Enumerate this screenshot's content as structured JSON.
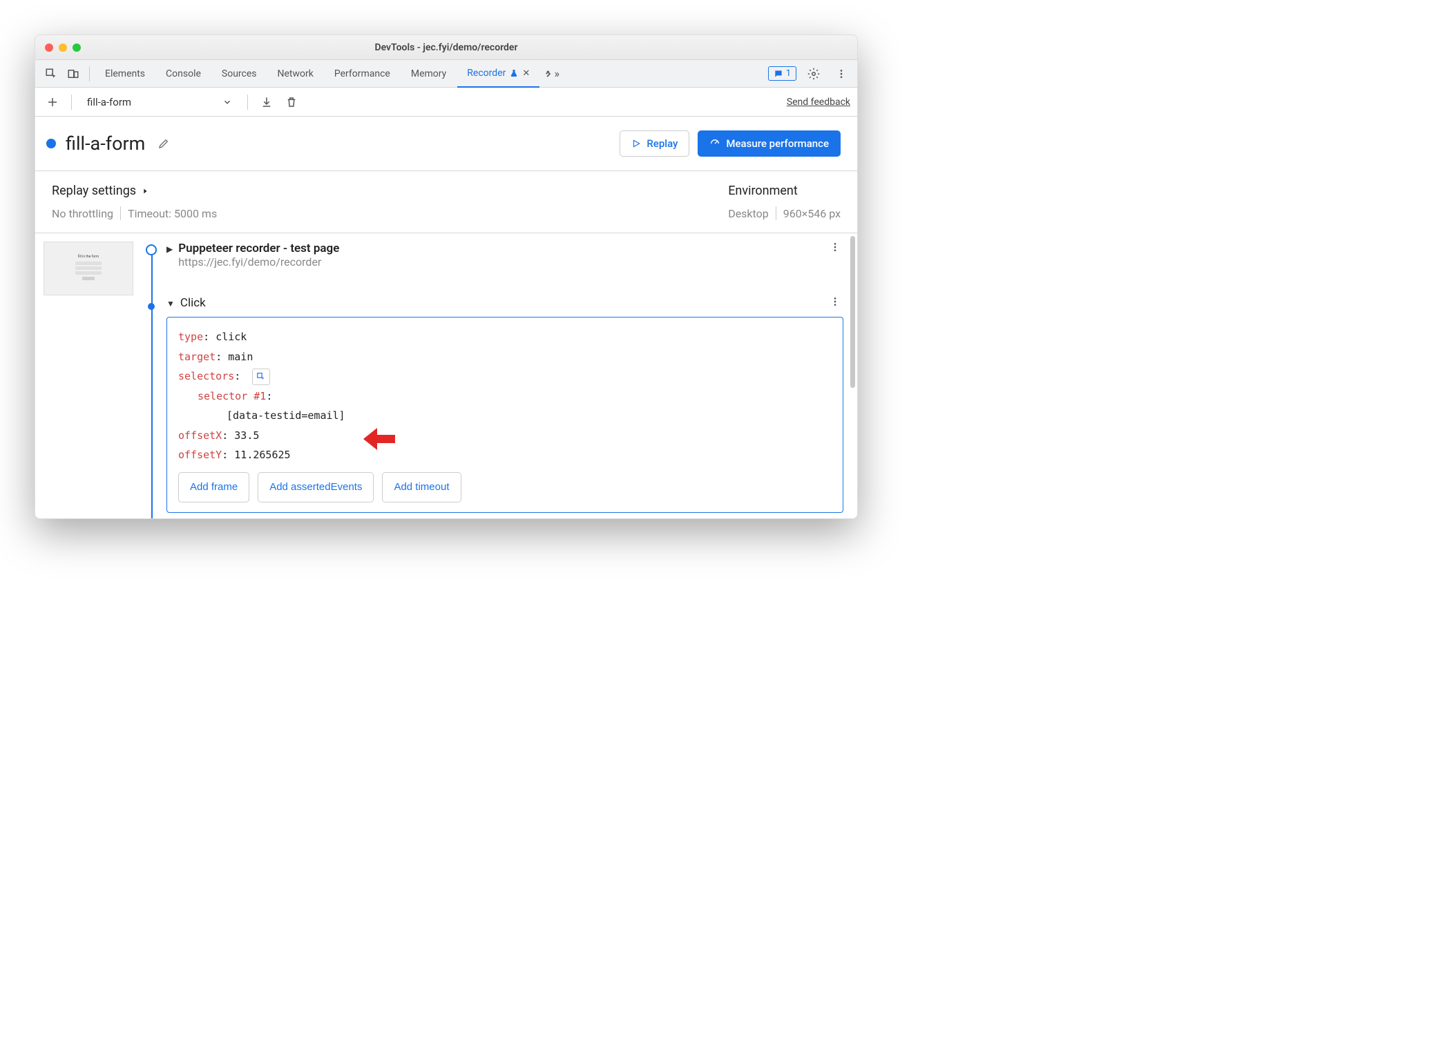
{
  "window": {
    "title": "DevTools - jec.fyi/demo/recorder"
  },
  "tabs": {
    "items": [
      "Elements",
      "Console",
      "Sources",
      "Network",
      "Performance",
      "Memory",
      "Recorder"
    ],
    "activeIndex": 6,
    "issuesCount": "1"
  },
  "toolbar": {
    "recordingName": "fill-a-form",
    "feedbackLabel": "Send feedback"
  },
  "header": {
    "title": "fill-a-form",
    "replayLabel": "Replay",
    "measureLabel": "Measure performance"
  },
  "settings": {
    "replayTitle": "Replay settings",
    "throttling": "No throttling",
    "timeout": "Timeout: 5000 ms",
    "envTitle": "Environment",
    "device": "Desktop",
    "viewport": "960×546 px"
  },
  "steps": {
    "first": {
      "title": "Puppeteer recorder - test page",
      "subtitle": "https://jec.fyi/demo/recorder"
    },
    "click": {
      "title": "Click",
      "type_key": "type",
      "type_val": "click",
      "target_key": "target",
      "target_val": "main",
      "selectors_key": "selectors",
      "selector1_key": "selector #1",
      "selector1_val": "[data-testid=email]",
      "offsetX_key": "offsetX",
      "offsetX_val": "33.5",
      "offsetY_key": "offsetY",
      "offsetY_val": "11.265625",
      "addFrame": "Add frame",
      "addAsserted": "Add assertedEvents",
      "addTimeout": "Add timeout"
    }
  }
}
